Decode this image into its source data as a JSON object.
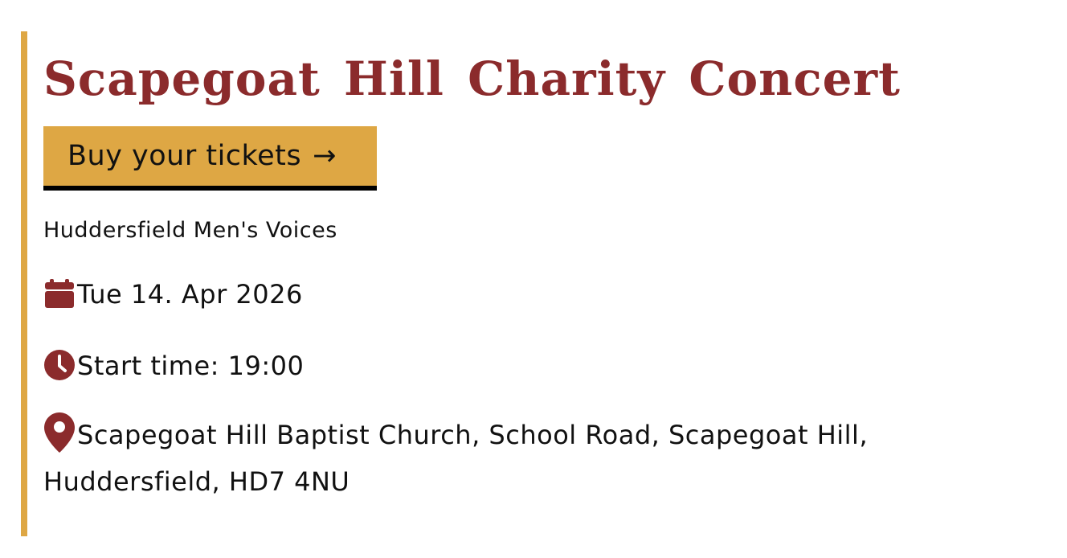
{
  "event": {
    "title": "Scapegoat Hill Charity Concert",
    "buy_button_label": "Buy your tickets",
    "buy_button_arrow": "→",
    "organiser": "Huddersfield Men's Voices",
    "date": "Tue 14. Apr 2026",
    "start_time": "Start time: 19:00",
    "location": "Scapegoat Hill Baptist Church, School Road, Scapegoat Hill, Huddersfield, HD7 4NU"
  },
  "icons": {
    "date": "calendar-icon",
    "time": "clock-icon",
    "location": "map-pin-icon",
    "button": "arrow-right-icon"
  },
  "colors": {
    "accent_gold": "#dea744",
    "brand_red": "#8b2b2c",
    "text": "#111111",
    "button_underline": "#000000",
    "background": "#ffffff"
  }
}
